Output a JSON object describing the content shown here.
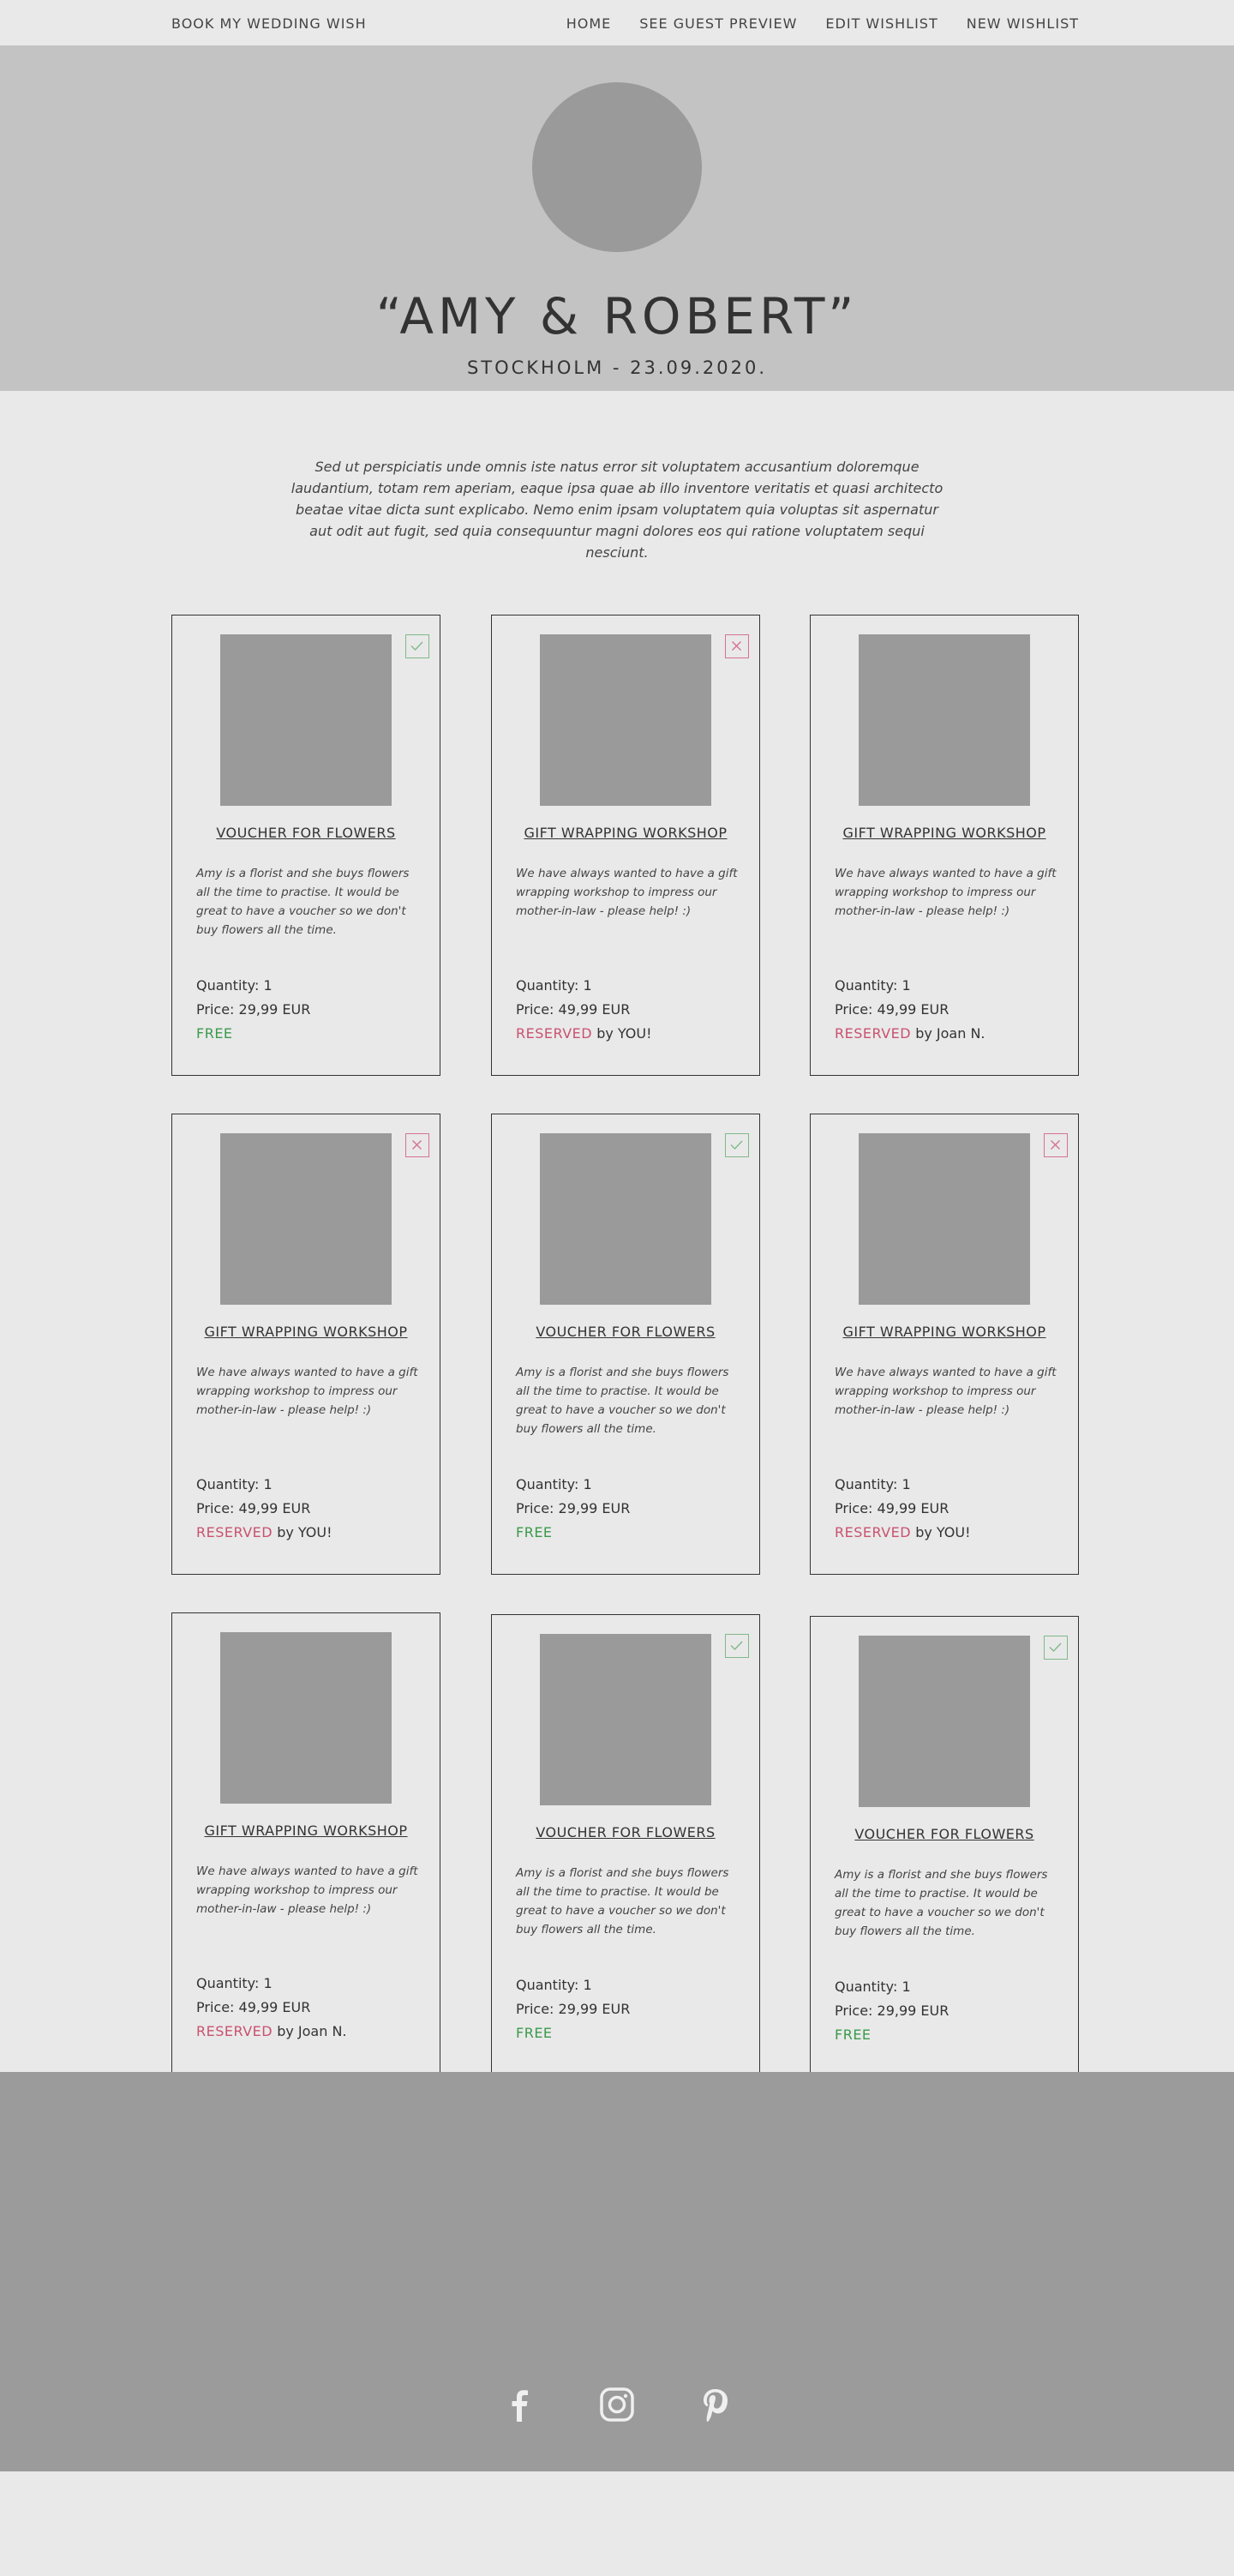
{
  "nav": {
    "brand": "BOOK MY WEDDING WISH",
    "links": [
      "HOME",
      "SEE GUEST PREVIEW",
      "EDIT WISHLIST",
      "NEW WISHLIST"
    ]
  },
  "hero": {
    "couple": "“AMY & ROBERT”",
    "place_date": "STOCKHOLM - 23.09.2020."
  },
  "intro": "Sed ut perspiciatis unde omnis iste natus error sit voluptatem accusantium doloremque laudantium, totam rem aperiam, eaque ipsa quae ab illo inventore veritatis et quasi architecto beatae vitae dicta sunt explicabo. Nemo enim ipsam voluptatem quia voluptas sit aspernatur aut odit aut fugit, sed quia consequuntur magni dolores eos qui ratione voluptatem sequi nesciunt.",
  "colors": {
    "free": "#3a9a4a",
    "reserved": "#c9526f",
    "check_border": "#7fb98a",
    "cross_border": "#d5728f",
    "hero_bg": "#c3c3c3",
    "footer_bg": "#9b9b9b"
  },
  "cards": [
    {
      "title": "VOUCHER FOR FLOWERS",
      "desc": "Amy is a florist and she buys flowers all the time to practise. It would be great to have a voucher so we don't buy flowers all the time.",
      "quantity": "Quantity: 1",
      "price": "Price: 29,99 EUR",
      "status": "FREE",
      "by": "",
      "badge": "check-icon"
    },
    {
      "title": "GIFT WRAPPING WORKSHOP",
      "desc": "We have always wanted to have a gift wrapping workshop to impress our mother-in-law - please help! :)",
      "quantity": "Quantity: 1",
      "price": "Price: 49,99 EUR",
      "status": "RESERVED",
      "by": " by YOU!",
      "badge": "cross-icon"
    },
    {
      "title": "GIFT WRAPPING WORKSHOP",
      "desc": "We have always wanted to have a gift wrapping workshop to impress our mother-in-law - please help! :)",
      "quantity": "Quantity: 1",
      "price": "Price: 49,99 EUR",
      "status": "RESERVED",
      "by": " by Joan N.",
      "badge": ""
    },
    {
      "title": "GIFT WRAPPING WORKSHOP",
      "desc": "We have always wanted to have a gift wrapping workshop to impress our mother-in-law - please help! :)",
      "quantity": "Quantity: 1",
      "price": "Price: 49,99 EUR",
      "status": "RESERVED",
      "by": " by YOU!",
      "badge": "cross-icon"
    },
    {
      "title": "VOUCHER FOR FLOWERS",
      "desc": "Amy is a florist and she buys flowers all the time to practise. It would be great to have a voucher so we don't buy flowers all the time.",
      "quantity": "Quantity: 1",
      "price": "Price: 29,99 EUR",
      "status": "FREE",
      "by": "",
      "badge": "check-icon"
    },
    {
      "title": "GIFT WRAPPING WORKSHOP",
      "desc": "We have always wanted to have a gift wrapping workshop to impress our mother-in-law - please help! :)",
      "quantity": "Quantity: 1",
      "price": "Price: 49,99 EUR",
      "status": "RESERVED",
      "by": " by YOU!",
      "badge": "cross-icon"
    },
    {
      "title": "GIFT WRAPPING WORKSHOP",
      "desc": "We have always wanted to have a gift wrapping workshop to impress our mother-in-law - please help! :)",
      "quantity": "Quantity: 1",
      "price": "Price: 49,99 EUR",
      "status": "RESERVED",
      "by": " by Joan N.",
      "badge": ""
    },
    {
      "title": "VOUCHER FOR FLOWERS",
      "desc": "Amy is a florist and she buys flowers all the time to practise. It would be great to have a voucher so we don't buy flowers all the time.",
      "quantity": "Quantity: 1",
      "price": "Price: 29,99 EUR",
      "status": "FREE",
      "by": "",
      "badge": "check-icon"
    },
    {
      "title": "VOUCHER FOR FLOWERS",
      "desc": "Amy is a florist and she buys flowers all the time to practise. It would be great to have a voucher so we don't buy flowers all the time.",
      "quantity": "Quantity: 1",
      "price": "Price: 29,99 EUR",
      "status": "FREE",
      "by": "",
      "badge": "check-icon"
    }
  ],
  "footer": {
    "social": [
      "facebook-icon",
      "instagram-icon",
      "pinterest-icon"
    ]
  }
}
